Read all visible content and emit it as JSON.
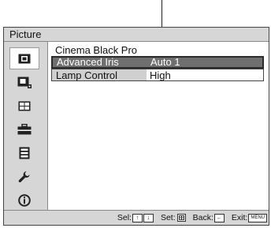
{
  "menu": {
    "title": "Picture"
  },
  "sidebar": {
    "items": [
      {
        "icon": "picture-icon",
        "selected": true
      },
      {
        "icon": "advanced-picture-icon",
        "selected": false
      },
      {
        "icon": "screen-icon",
        "selected": false
      },
      {
        "icon": "setup-icon",
        "selected": false
      },
      {
        "icon": "function-icon",
        "selected": false
      },
      {
        "icon": "installation-icon",
        "selected": false
      },
      {
        "icon": "information-icon",
        "selected": false
      }
    ]
  },
  "submenu": {
    "title": "Cinema Black Pro",
    "items": [
      {
        "label": "Advanced Iris",
        "value": "Auto 1"
      },
      {
        "label": "Lamp Control",
        "value": "High"
      }
    ]
  },
  "status": {
    "sel_label": "Sel:",
    "sel_keys": [
      "↑",
      "↓"
    ],
    "set_label": "Set:",
    "back_label": "Back:",
    "back_key": "←",
    "exit_label": "Exit:",
    "exit_key": "MENU"
  }
}
